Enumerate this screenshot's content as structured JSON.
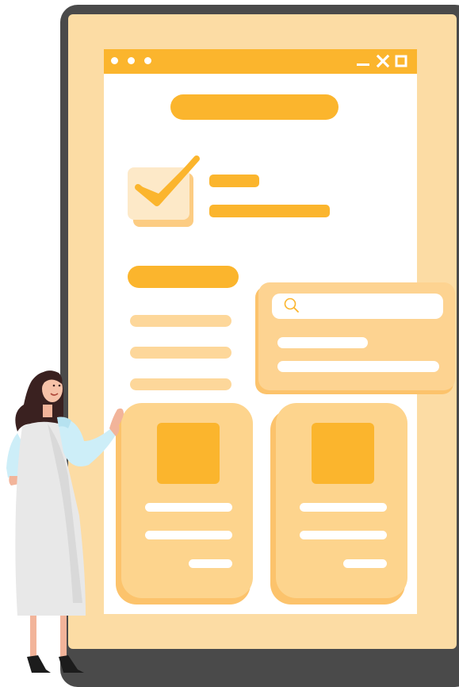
{
  "window": {
    "controls": {
      "minimize_icon": "minimize-icon",
      "close_icon": "close-icon",
      "maximize_icon": "maximize-icon"
    }
  },
  "checkbox": {
    "checked": true,
    "icon": "checkmark-icon"
  },
  "search": {
    "placeholder": "",
    "value": "",
    "icon": "search-icon"
  },
  "colors": {
    "accent": "#fbb52d",
    "pale_accent": "#fdd79a",
    "device_frame": "#4a4a4a",
    "device_screen": "#fcdca4",
    "window_background": "#ffffff"
  }
}
